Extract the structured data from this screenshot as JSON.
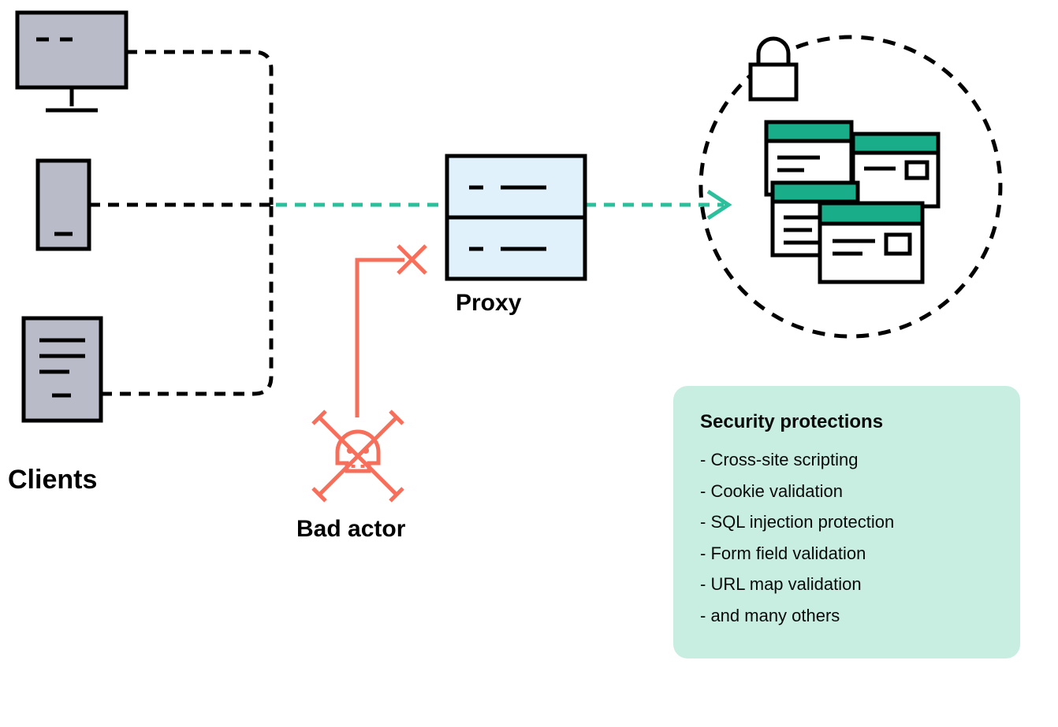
{
  "labels": {
    "clients": "Clients",
    "proxy": "Proxy",
    "bad_actor": "Bad actor"
  },
  "security_box": {
    "title": "Security protections",
    "items": [
      "Cross-site scripting",
      "Cookie validation",
      "SQL injection protection",
      "Form field validation",
      "URL map validation",
      "and many others"
    ]
  },
  "colors": {
    "fill_gray": "#b9bcc8",
    "stroke_black": "#000000",
    "stroke_red": "#f56f5b",
    "stroke_teal": "#2bbf9c",
    "fill_teal": "#19ad8a",
    "fill_lightblue": "#e0f1fb",
    "box_bg": "#c7eee1"
  }
}
